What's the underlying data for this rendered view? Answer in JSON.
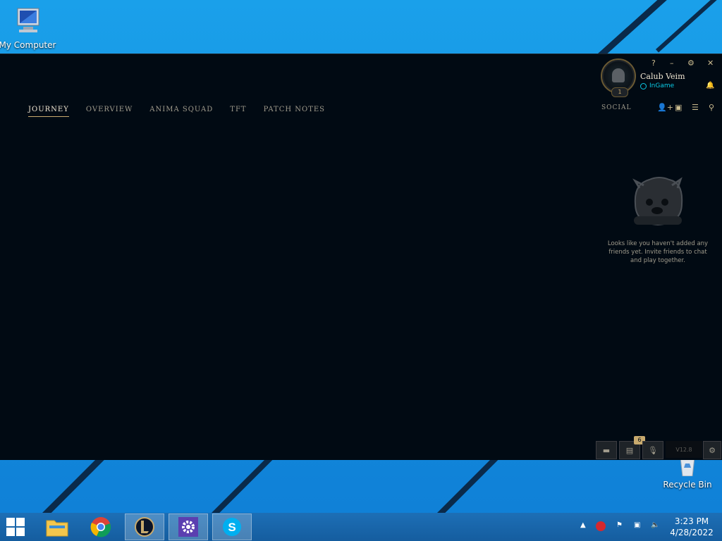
{
  "desktop": {
    "icons": [
      {
        "label": "My Computer",
        "icon": "computer-icon"
      },
      {
        "label": "Recycle Bin",
        "icon": "recycle-bin-icon"
      }
    ]
  },
  "client": {
    "nav": [
      "JOURNEY",
      "OVERVIEW",
      "ANIMA SQUAD",
      "TFT",
      "PATCH NOTES"
    ],
    "active_nav": "JOURNEY",
    "profile": {
      "name": "Calub Veim",
      "status": "InGame",
      "level": "1"
    },
    "window_controls": [
      "?",
      "–",
      "⚙",
      "✕"
    ],
    "social": {
      "label": "SOCIAL",
      "empty_message": "Looks like you haven't added any friends yet. Invite friends to chat and play together."
    },
    "bottom_bar": {
      "badge_count": "6",
      "version": "V12.8"
    },
    "colors": {
      "bg": "#010a13",
      "gold": "#c8aa6e",
      "status": "#0acbe6"
    }
  },
  "taskbar": {
    "time": "3:23 PM",
    "date": "4/28/2022"
  }
}
